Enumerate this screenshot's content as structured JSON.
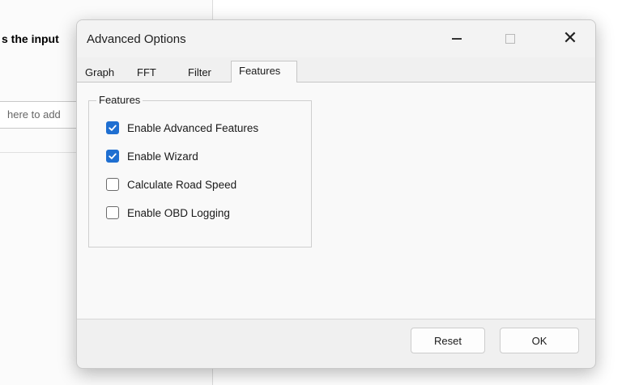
{
  "background_app": {
    "heading_fragment": "s the input",
    "input_placeholder_fragment": "here to add"
  },
  "dialog": {
    "title": "Advanced Options",
    "window_controls": {
      "minimize_icon": "minimize-icon",
      "maximize_icon": "maximize-icon",
      "close_icon": "close-icon",
      "close_glyph": "✕"
    },
    "tabs": [
      {
        "label": "Graph",
        "active": false
      },
      {
        "label": "FFT",
        "active": false
      },
      {
        "label": "Filter",
        "active": false
      },
      {
        "label": "Features",
        "active": true
      }
    ],
    "features_group": {
      "legend": "Features",
      "options": [
        {
          "label": "Enable Advanced Features",
          "checked": true
        },
        {
          "label": "Enable Wizard",
          "checked": true
        },
        {
          "label": "Calculate Road Speed",
          "checked": false
        },
        {
          "label": "Enable OBD Logging",
          "checked": false
        }
      ]
    },
    "buttons": {
      "reset": "Reset",
      "ok": "OK"
    }
  },
  "colors": {
    "checkbox_checked": "#1f6fd1",
    "dialog_background": "#f0f0f0",
    "content_background": "#f9f9f9"
  }
}
